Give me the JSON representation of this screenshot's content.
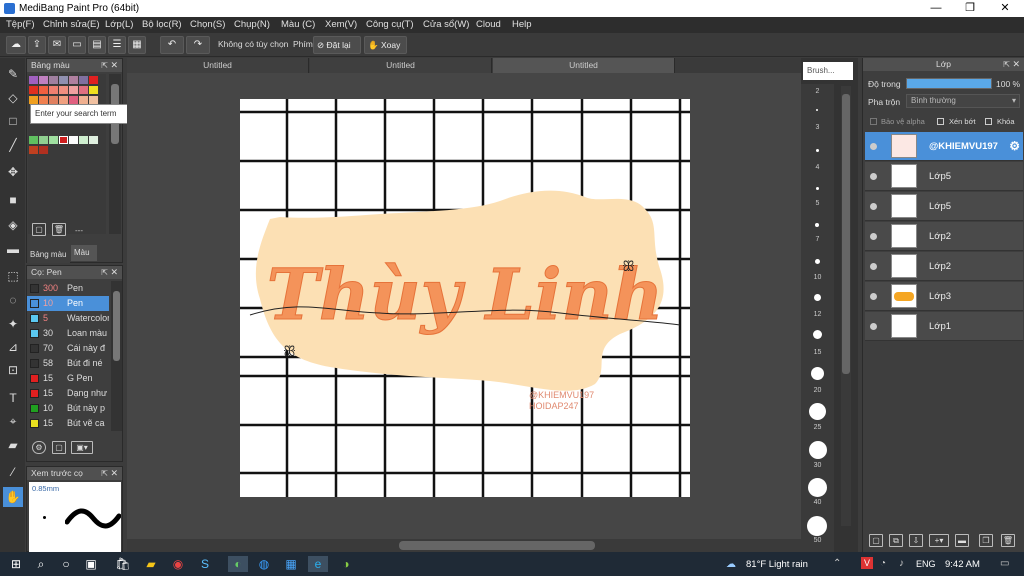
{
  "window": {
    "title": "MediBang Paint Pro (64bit)",
    "minimize": "—",
    "restore": "❐",
    "close": "✕"
  },
  "menu": [
    "Tệp(F)",
    "Chỉnh sửa(E)",
    "Lớp(L)",
    "Bộ lọc(R)",
    "Chọn(S)",
    "Chụp(N)",
    "Màu (C)",
    "Xem(V)",
    "Công cụ(T)",
    "Cửa sổ(W)",
    "Cloud",
    "Help"
  ],
  "toolbar": {
    "no_option": "Không có tùy chọn",
    "key_label": "Phím",
    "reset": "Đặt lại",
    "rotate": "Xoay"
  },
  "color_panel": {
    "title": "Bảng màu",
    "tooltip_placeholder": "Enter your search term",
    "tab_palette": "Bảng màu",
    "tab_color": "Màu",
    "dash": "---"
  },
  "brush_panel": {
    "title": "Cọ: Pen",
    "items": [
      {
        "size": "300",
        "name": "Pen",
        "color": "#333333"
      },
      {
        "size": "10",
        "name": "Pen",
        "color": "#4a90d9"
      },
      {
        "size": "5",
        "name": "Watercolor",
        "color": "#5bc8f0"
      },
      {
        "size": "30",
        "name": "Loan màu",
        "color": "#5bc8f0"
      },
      {
        "size": "70",
        "name": "Cái này đ",
        "color": "#333333"
      },
      {
        "size": "58",
        "name": "Bút đi né",
        "color": "#333333"
      },
      {
        "size": "15",
        "name": "G Pen",
        "color": "#e02020"
      },
      {
        "size": "15",
        "name": "Dạng như",
        "color": "#e02020"
      },
      {
        "size": "10",
        "name": "Bút này p",
        "color": "#20a020"
      },
      {
        "size": "15",
        "name": "Bút vẽ ca",
        "color": "#e8e020"
      }
    ]
  },
  "preview_panel": {
    "title": "Xem trước cọ",
    "size": "0.85mm"
  },
  "tabs": [
    "Untitled",
    "Untitled",
    "Untitled"
  ],
  "artwork": {
    "title": "Thùy Linh",
    "watermark_1": "@KHIEMVU197",
    "watermark_2": "HOIDAP247"
  },
  "brush_column": {
    "header": "Brush...",
    "sizes": [
      "2",
      "3",
      "4",
      "5",
      "7",
      "10",
      "12",
      "15",
      "20",
      "25",
      "30",
      "40",
      "50"
    ]
  },
  "layer_panel": {
    "title": "Lớp",
    "opacity_label": "Độ trong",
    "opacity_value": "100 %",
    "opacity": 1.0,
    "blend_label": "Pha trộn",
    "blend_value": "Bình thường",
    "protect_alpha": "Bảo vệ alpha",
    "clipping": "Xén bớt",
    "lock": "Khóa",
    "layers": [
      {
        "name": "@KHIEMVU197",
        "selected": true
      },
      {
        "name": "Lớp5",
        "selected": false
      },
      {
        "name": "Lớp5",
        "selected": false
      },
      {
        "name": "Lớp2",
        "selected": false
      },
      {
        "name": "Lớp2",
        "selected": false
      },
      {
        "name": "Lớp3",
        "selected": false
      },
      {
        "name": "Lớp1",
        "selected": false
      }
    ]
  },
  "taskbar": {
    "weather": "81°F  Light rain",
    "lang": "ENG",
    "time": "9:42 AM"
  },
  "colors": {
    "accent": "#4a90d9",
    "blob": "#fce0b4",
    "lettering": "#f4935a"
  }
}
